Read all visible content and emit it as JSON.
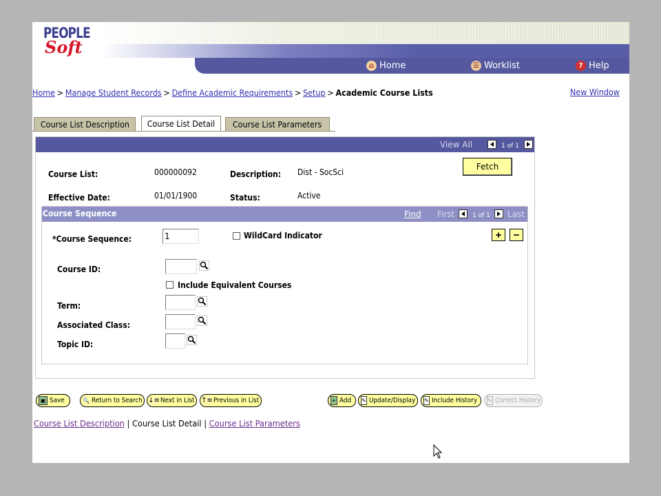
{
  "header": {
    "logo_people": "PEOPLE",
    "logo_soft": "Soft",
    "nav": {
      "home": "Home",
      "worklist": "Worklist",
      "help": "Help"
    }
  },
  "breadcrumb": {
    "items": [
      "Home",
      "Manage Student Records",
      "Define Academic Requirements",
      "Setup"
    ],
    "current": "Academic Course Lists",
    "separator": ">"
  },
  "new_window": "New Window",
  "tabs": [
    {
      "label": "Course List Description",
      "active": false
    },
    {
      "label": "Course List Detail",
      "active": true
    },
    {
      "label": "Course List Parameters",
      "active": false
    }
  ],
  "panel": {
    "view_all": "View All",
    "pagination": "1 of 1",
    "fetch_label": "Fetch",
    "course_list_label": "Course List:",
    "course_list_value": "000000092",
    "description_label": "Description:",
    "description_value": "Dist - SocSci",
    "effective_date_label": "Effective Date:",
    "effective_date_value": "01/01/1900",
    "status_label": "Status:",
    "status_value": "Active"
  },
  "course_sequence": {
    "title": "Course Sequence",
    "find": "Find",
    "first": "First",
    "pagination": "1 of 1",
    "last": "Last",
    "sequence_label": "*Course Sequence:",
    "sequence_value": "1",
    "wildcard_label": "WildCard Indicator",
    "course_id_label": "Course ID:",
    "include_equiv_label": "Include Equivalent Courses",
    "term_label": "Term:",
    "assoc_class_label": "Associated Class:",
    "topic_id_label": "Topic ID:",
    "add_row": "+",
    "delete_row": "−"
  },
  "toolbar": {
    "save": "Save",
    "return_to_search": "Return to Search",
    "next_in_list": "Next in List",
    "previous_in_list": "Previous in List",
    "add": "Add",
    "update_display": "Update/Display",
    "include_history": "Include History",
    "correct_history": "Correct History"
  },
  "footer_links": {
    "description": "Course List Description",
    "detail": "Course List Detail",
    "parameters": "Course List Parameters",
    "separator": "|"
  },
  "colors": {
    "nav_bar": "#55589f",
    "sub_bar": "#8d8fc5",
    "button_yellow": "#ffffa0",
    "tab_inactive": "#c7c4a8",
    "link": "#3030b0"
  }
}
